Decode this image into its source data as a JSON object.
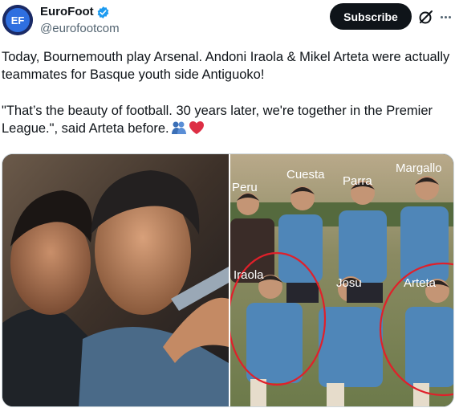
{
  "author": {
    "display_name": "EuroFoot",
    "handle": "@eurofootcom",
    "avatar_text": "EF",
    "verified": true
  },
  "actions": {
    "subscribe_label": "Subscribe"
  },
  "tweet": {
    "line1": "Today, Bournemouth play Arsenal. Andoni Iraola & Mikel Arteta were actually teammates for Basque youth side Antiguoko!",
    "line2": "\"That’s the beauty of football. 30 years later, we're together in the Premier League.\", said Arteta before."
  },
  "media": {
    "right_photo_labels": [
      "Peru",
      "Cuesta",
      "Parra",
      "Margallo",
      "Iraola",
      "Josu",
      "Arteta"
    ]
  },
  "colors": {
    "accent_blue": "#1d9bf0",
    "text_primary": "#0f1419",
    "text_secondary": "#536471",
    "circle_red": "#e0202a"
  }
}
